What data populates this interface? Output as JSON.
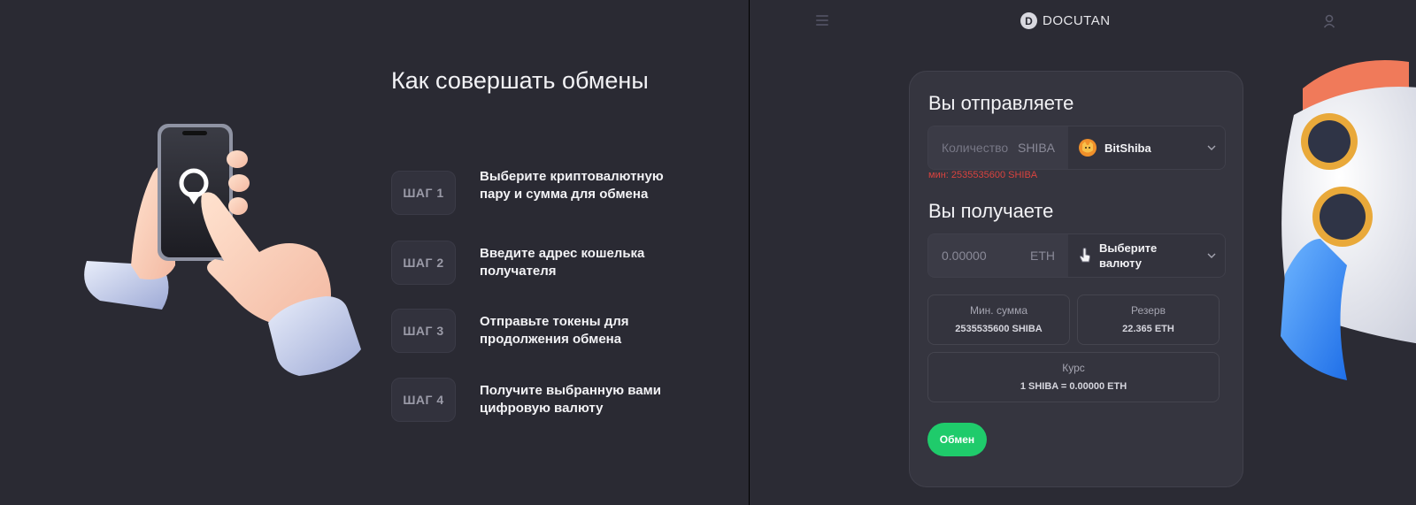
{
  "left": {
    "title": "Как совершать обмены",
    "steps": [
      {
        "badge": "ШАГ 1",
        "text": "Выберите криптовалютную пару и сумма для обмена"
      },
      {
        "badge": "ШАГ 2",
        "text": "Введите адрес кошелька получателя"
      },
      {
        "badge": "ШАГ 3",
        "text": "Отправьте токены для продолжения обмена"
      },
      {
        "badge": "ШАГ 4",
        "text": "Получите выбранную вами цифровую валюту"
      }
    ]
  },
  "header": {
    "menu_icon": "hamburger-icon",
    "logo_letter": "D",
    "brand": "DOCUTAN",
    "user_icon": "user-icon"
  },
  "form": {
    "send_heading": "Вы отправляете",
    "send_amount_placeholder": "Количество",
    "send_currency_code": "SHIBA",
    "send_currency_name": "BitShiba",
    "min_note": "мин: 2535535600 SHIBA",
    "receive_heading": "Вы получаете",
    "receive_amount": "0.00000",
    "receive_currency_code": "ETH",
    "receive_select_placeholder": "Выберите валюту",
    "info": {
      "min_label": "Мин. сумма",
      "min_value": "2535535600 SHIBA",
      "reserve_label": "Резерв",
      "reserve_value": "22.365 ETH",
      "rate_label": "Курс",
      "rate_value": "1 SHIBA = 0.00000 ETH"
    },
    "exchange_button": "Обмен"
  },
  "colors": {
    "accent_green": "#1fcb6b",
    "error_red": "#d9433f",
    "background": "#2b2b34"
  }
}
